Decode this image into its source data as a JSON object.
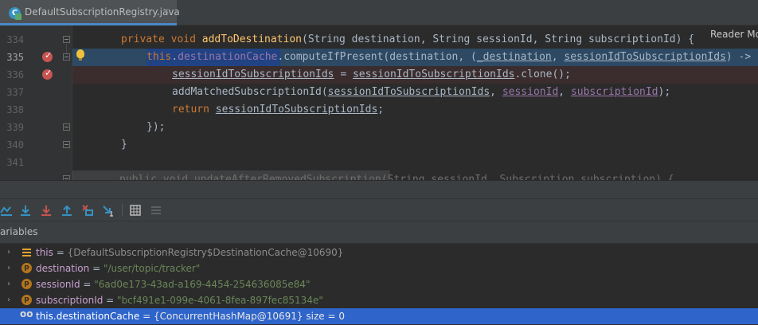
{
  "tab": {
    "file_name": "DefaultSubscriptionRegistry.java",
    "close": "×"
  },
  "editor": {
    "reader_mode": "Reader Mode",
    "line_numbers": [
      "334",
      "335",
      "336",
      "337",
      "338",
      "339",
      "340",
      "341"
    ],
    "lines": {
      "l334": {
        "kw1": "private",
        "kw2": "void",
        "fn": "addToDestination",
        "rest": "(String destination, String sessionId, String subscriptionId) {"
      },
      "l335": {
        "kw": "this",
        "dot": ".",
        "field": "destinationCache",
        "call": ".computeIfPresent(destination, (",
        "param1": "_destination",
        "comma": ", ",
        "param2": "sessionIdToSubscriptionIds",
        "arrow": ") -> {"
      },
      "l336": {
        "var1": "sessionIdToSubscriptionIds",
        "eq": " = ",
        "var2": "sessionIdToSubscriptionIds",
        "call": ".clone();"
      },
      "l337": {
        "fn": "addMatchedSubscriptionId(",
        "a1": "sessionIdToSubscriptionIds",
        "c1": ", ",
        "a2": "sessionId",
        "c2": ", ",
        "a3": "subscriptionId",
        "end": ");"
      },
      "l338": {
        "kw": "return",
        "sp": " ",
        "var": "sessionIdToSubscriptionIds",
        "end": ";"
      },
      "l339": {
        "text": "});"
      },
      "l340": {
        "text": "}"
      },
      "l341": {
        "text": "public void updateAfterRemovedSubscription(String sessionId, Subscription subscription) {"
      }
    }
  },
  "debugger": {
    "panel_label": "ariables",
    "variables": [
      {
        "name": "this",
        "eq": " = ",
        "value": "{DefaultSubscriptionRegistry$DestinationCache@10690}",
        "icon": "field-icon"
      },
      {
        "name": "destination",
        "eq": " = ",
        "value": "\"/user/topic/tracker\"",
        "icon": "parameter-icon"
      },
      {
        "name": "sessionId",
        "eq": " = ",
        "value": "\"6ad0e173-43ad-a169-4454-254636085e84\"",
        "icon": "parameter-icon"
      },
      {
        "name": "subscriptionId",
        "eq": " = ",
        "value": "\"bcf491e1-099e-4061-8fea-897fec85134e\"",
        "icon": "parameter-icon"
      },
      {
        "name": "this.destinationCache",
        "eq": " = ",
        "value": "{ConcurrentHashMap@10691}",
        "extra": "  size = 0",
        "icon": "watch-icon"
      }
    ],
    "param_letter": "p",
    "watch_glyph": "oo",
    "expand_glyph": "›"
  }
}
